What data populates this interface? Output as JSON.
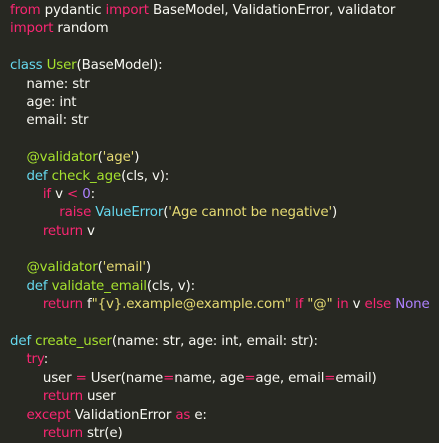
{
  "editor": {
    "theme": {
      "background": "#272822",
      "text": "#f8f8f2",
      "keyword": "#f92672",
      "function": "#a6e22e",
      "string": "#e6db74",
      "number": "#ae81ff",
      "builtin": "#66d9ef"
    },
    "lines": [
      [
        [
          "kw",
          "from"
        ],
        [
          "txt",
          " pydantic "
        ],
        [
          "kw",
          "import"
        ],
        [
          "txt",
          " BaseModel, ValidationError, validator"
        ]
      ],
      [
        [
          "kw",
          "import"
        ],
        [
          "txt",
          " random"
        ]
      ],
      [],
      [
        [
          "def",
          "class"
        ],
        [
          "txt",
          " "
        ],
        [
          "cls",
          "User"
        ],
        [
          "txt",
          "(BaseModel):"
        ]
      ],
      [
        [
          "txt",
          "    name: str"
        ]
      ],
      [
        [
          "txt",
          "    age: int"
        ]
      ],
      [
        [
          "txt",
          "    email: str"
        ]
      ],
      [],
      [
        [
          "txt",
          "    "
        ],
        [
          "dec",
          "@validator"
        ],
        [
          "txt",
          "("
        ],
        [
          "str",
          "'age'"
        ],
        [
          "txt",
          ")"
        ]
      ],
      [
        [
          "txt",
          "    "
        ],
        [
          "def",
          "def"
        ],
        [
          "txt",
          " "
        ],
        [
          "fn",
          "check_age"
        ],
        [
          "txt",
          "(cls, v):"
        ]
      ],
      [
        [
          "txt",
          "        "
        ],
        [
          "kw",
          "if"
        ],
        [
          "txt",
          " v "
        ],
        [
          "op",
          "<"
        ],
        [
          "txt",
          " "
        ],
        [
          "num",
          "0"
        ],
        [
          "txt",
          ":"
        ]
      ],
      [
        [
          "txt",
          "            "
        ],
        [
          "kw",
          "raise"
        ],
        [
          "txt",
          " "
        ],
        [
          "builtin",
          "ValueError"
        ],
        [
          "txt",
          "("
        ],
        [
          "str",
          "'Age cannot be negative'"
        ],
        [
          "txt",
          ")"
        ]
      ],
      [
        [
          "txt",
          "        "
        ],
        [
          "kw",
          "return"
        ],
        [
          "txt",
          " v"
        ]
      ],
      [],
      [
        [
          "txt",
          "    "
        ],
        [
          "dec",
          "@validator"
        ],
        [
          "txt",
          "("
        ],
        [
          "str",
          "'email'"
        ],
        [
          "txt",
          ")"
        ]
      ],
      [
        [
          "txt",
          "    "
        ],
        [
          "def",
          "def"
        ],
        [
          "txt",
          " "
        ],
        [
          "fn",
          "validate_email"
        ],
        [
          "txt",
          "(cls, v):"
        ]
      ],
      [
        [
          "txt",
          "        "
        ],
        [
          "kw",
          "return"
        ],
        [
          "txt",
          " f"
        ],
        [
          "str",
          "\"{v}.example@example.com\""
        ],
        [
          "txt",
          " "
        ],
        [
          "kw",
          "if"
        ],
        [
          "txt",
          " "
        ],
        [
          "str",
          "\"@\""
        ],
        [
          "txt",
          " "
        ],
        [
          "kw",
          "in"
        ],
        [
          "txt",
          " v "
        ],
        [
          "kw",
          "else"
        ],
        [
          "txt",
          " "
        ],
        [
          "const",
          "None"
        ]
      ],
      [],
      [
        [
          "def",
          "def"
        ],
        [
          "txt",
          " "
        ],
        [
          "fn",
          "create_user"
        ],
        [
          "txt",
          "(name: str, age: int, email: str):"
        ]
      ],
      [
        [
          "txt",
          "    "
        ],
        [
          "kw",
          "try"
        ],
        [
          "txt",
          ":"
        ]
      ],
      [
        [
          "txt",
          "        user "
        ],
        [
          "op",
          "="
        ],
        [
          "txt",
          " User(name"
        ],
        [
          "op",
          "="
        ],
        [
          "txt",
          "name, age"
        ],
        [
          "op",
          "="
        ],
        [
          "txt",
          "age, email"
        ],
        [
          "op",
          "="
        ],
        [
          "txt",
          "email)"
        ]
      ],
      [
        [
          "txt",
          "        "
        ],
        [
          "kw",
          "return"
        ],
        [
          "txt",
          " user"
        ]
      ],
      [
        [
          "txt",
          "    "
        ],
        [
          "kw",
          "except"
        ],
        [
          "txt",
          " ValidationError "
        ],
        [
          "kw",
          "as"
        ],
        [
          "txt",
          " e:"
        ]
      ],
      [
        [
          "txt",
          "        "
        ],
        [
          "kw",
          "return"
        ],
        [
          "txt",
          " str(e)"
        ]
      ]
    ]
  }
}
